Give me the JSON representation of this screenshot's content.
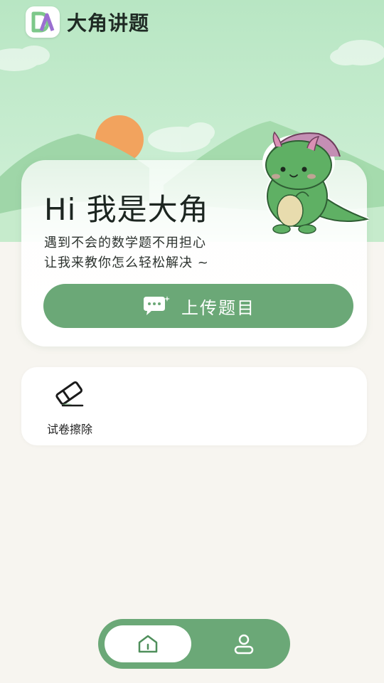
{
  "app": {
    "title": "大角讲题",
    "logo_icon": "dajiao-logo-icon"
  },
  "hero": {
    "greeting": "Hi 我是大角",
    "subtitle_line1": "遇到不会的数学题不用担心",
    "subtitle_line2": "让我来教你怎么轻松解决 ~",
    "upload_button": {
      "label": "上传题目",
      "icon": "chat-bubble-icon"
    },
    "mascot": "dinosaur-mascot"
  },
  "tools": [
    {
      "label": "试卷擦除",
      "icon": "eraser-icon"
    }
  ],
  "bottom_nav": [
    {
      "icon": "home-icon",
      "active": true
    },
    {
      "icon": "profile-icon",
      "active": false
    }
  ],
  "colors": {
    "accent_green": "#6ba877",
    "sky_green": "#c4eccd",
    "sun_orange": "#f2a35e",
    "mascot_green": "#5fb064",
    "page_background": "#f7f5f0"
  }
}
